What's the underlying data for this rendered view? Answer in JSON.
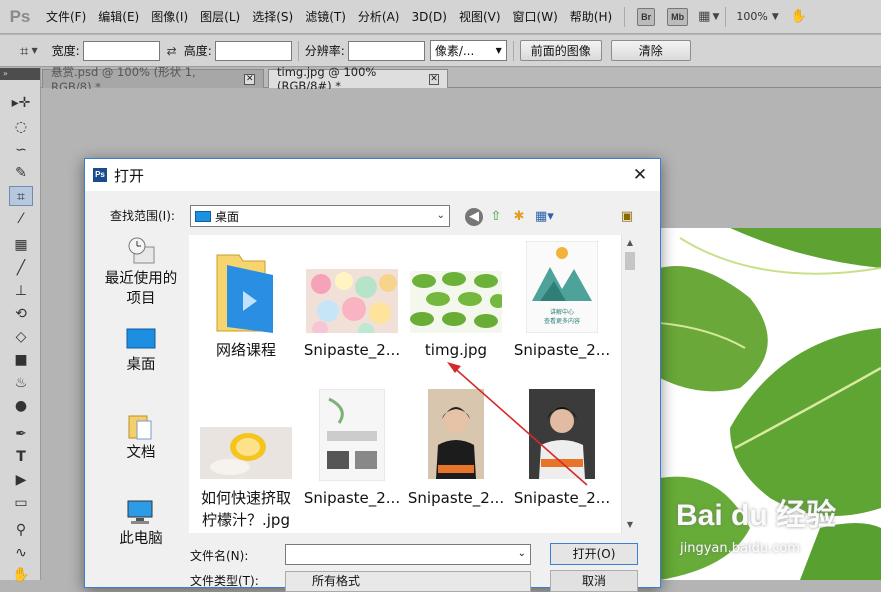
{
  "menubar": {
    "logo": "Ps",
    "items": [
      "文件(F)",
      "编辑(E)",
      "图像(I)",
      "图层(L)",
      "选择(S)",
      "滤镜(T)",
      "分析(A)",
      "3D(D)",
      "视图(V)",
      "窗口(W)",
      "帮助(H)"
    ],
    "bridge_label": "Br",
    "minibridge_label": "Mb",
    "zoom": "100%"
  },
  "options": {
    "width_label": "宽度:",
    "height_label": "高度:",
    "resolution_label": "分辨率:",
    "unit": "像素/...",
    "front_image": "前面的图像",
    "clear": "清除"
  },
  "tabs": [
    {
      "title": "悬赏.psd @ 100% (形状 1, RGB/8) *"
    },
    {
      "title": "timg.jpg @ 100%(RGB/8#) *"
    }
  ],
  "toolbar": {
    "collapse": "»"
  },
  "dialog": {
    "title": "打开",
    "close": "✕",
    "lookin_label": "查找范围(I):",
    "lookin_value": "桌面",
    "places": [
      {
        "label": "最近使用的项目",
        "icon": "recent-places-icon"
      },
      {
        "label": "桌面",
        "icon": "desktop-icon"
      },
      {
        "label": "文档",
        "icon": "documents-icon"
      },
      {
        "label": "此电脑",
        "icon": "computer-icon"
      }
    ],
    "files": [
      {
        "name": "网络课程",
        "icon": "folder-icon"
      },
      {
        "name": "Snipaste_2...",
        "icon": "image-candy-icon"
      },
      {
        "name": "timg.jpg",
        "icon": "image-leaves-icon"
      },
      {
        "name": "Snipaste_2...",
        "icon": "image-mountain-icon"
      },
      {
        "name": "如何快速挤取柠檬汁？.jpg",
        "name_line1": "如何快速挤取",
        "name_line2": "柠檬汁？.jpg",
        "icon": "image-lemon-icon"
      },
      {
        "name": "Snipaste_2...",
        "icon": "image-kitchen-icon"
      },
      {
        "name": "Snipaste_2...",
        "icon": "image-presenter-icon"
      },
      {
        "name": "Snipaste_2...",
        "icon": "image-presenter2-icon"
      }
    ],
    "mountain_caption_line1": "讲解中心",
    "mountain_caption_line2": "查看更多内容",
    "filename_label": "文件名(N):",
    "filename_value": "",
    "open_button": "打开(O)",
    "filetype_label": "文件类型(T):",
    "filetype_value": "所有格式",
    "cancel_button": "取消"
  },
  "watermark": {
    "text": "Bai du 经验",
    "sub": "jingyan.baidu.com"
  }
}
